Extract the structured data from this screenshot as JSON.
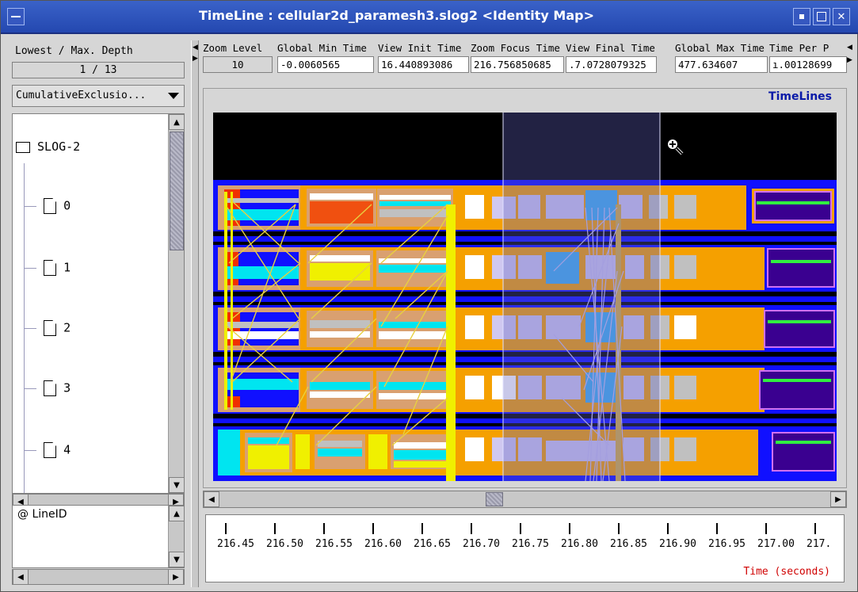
{
  "window": {
    "title": "TimeLine : cellular2d_paramesh3.slog2  <Identity Map>"
  },
  "left_panel": {
    "depth_label": "Lowest / Max. Depth",
    "depth_value": "1 / 13",
    "combo_value": "CumulativeExclusio...",
    "tree_root": "SLOG-2",
    "tree_items": [
      "0",
      "1",
      "2",
      "3",
      "4"
    ],
    "lineid_label": "@ LineID"
  },
  "toolbar": {
    "fields": [
      {
        "label": "Zoom Level",
        "value": "10"
      },
      {
        "label": "Global Min Time",
        "value": "-0.0060565"
      },
      {
        "label": "View  Init Time",
        "value": "16.440893086"
      },
      {
        "label": "Zoom Focus Time",
        "value": "216.756850685"
      },
      {
        "label": "View Final Time",
        "value": ".7.0728079325"
      },
      {
        "label": "Global Max Time",
        "value": "477.634607"
      },
      {
        "label": "Time Per P",
        "value": "ı.00128699"
      }
    ]
  },
  "timeline": {
    "frame_title": "TimeLines",
    "axis_title": "Time (seconds)",
    "tick_labels": [
      "216.45",
      "216.50",
      "216.55",
      "216.60",
      "216.65",
      "216.70",
      "216.75",
      "216.80",
      "216.85",
      "216.90",
      "216.95",
      "217.00",
      "217."
    ],
    "colors": {
      "background": "#000000",
      "row_band": "#1010ff",
      "state_orange": "#f5a000",
      "state_tan": "#d9a070",
      "state_cyan": "#00e5f0",
      "state_yellow": "#f0f000",
      "state_red": "#f03000",
      "state_purple": "#3a0090",
      "state_lavender": "#d0c8f0",
      "state_blue": "#40b0f0",
      "state_gray": "#c0c0c0",
      "arrow_yellow": "#e8d040",
      "arrow_lavender": "#c8c0f0",
      "selection": "#5050a0"
    }
  }
}
